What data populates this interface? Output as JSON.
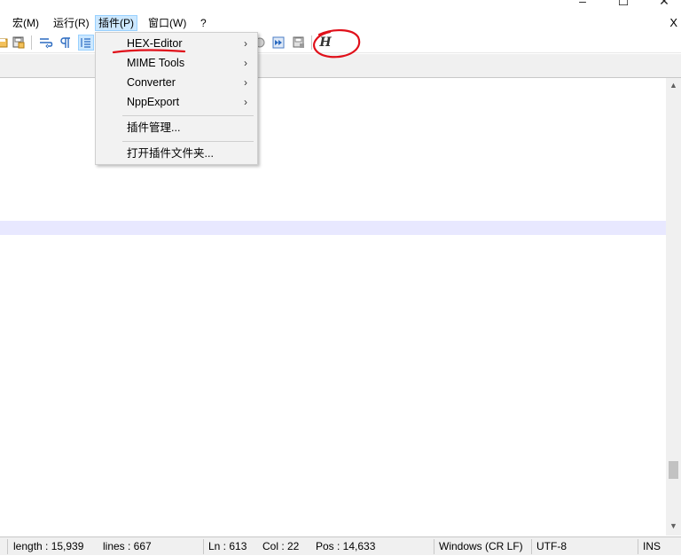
{
  "window": {
    "minimize_glyph": "–",
    "maximize_glyph": "☐",
    "close_glyph": "✕"
  },
  "menubar": {
    "items": [
      {
        "label": "宏(M)"
      },
      {
        "label": "运行(R)"
      },
      {
        "label": "插件(P)"
      },
      {
        "label": "窗口(W)"
      },
      {
        "label": "?"
      }
    ],
    "doc_close": "X"
  },
  "toolbar": {
    "hex_button_label": "H"
  },
  "plugins_menu": {
    "items": [
      {
        "label": "HEX-Editor",
        "submenu": true
      },
      {
        "label": "MIME Tools",
        "submenu": true
      },
      {
        "label": "Converter",
        "submenu": true
      },
      {
        "label": "NppExport",
        "submenu": true
      }
    ],
    "manage_label": "插件管理...",
    "open_folder_label": "打开插件文件夹...",
    "submenu_arrow": "›"
  },
  "statusbar": {
    "length": "length : 15,939",
    "lines": "lines : 667",
    "ln": "Ln : 613",
    "col": "Col : 22",
    "pos": "Pos : 14,633",
    "eol": "Windows (CR LF)",
    "encoding": "UTF-8",
    "mode": "INS"
  },
  "colors": {
    "menu_highlight": "#cce8ff",
    "current_line": "#e8e8ff",
    "annotation": "#e0101a"
  }
}
